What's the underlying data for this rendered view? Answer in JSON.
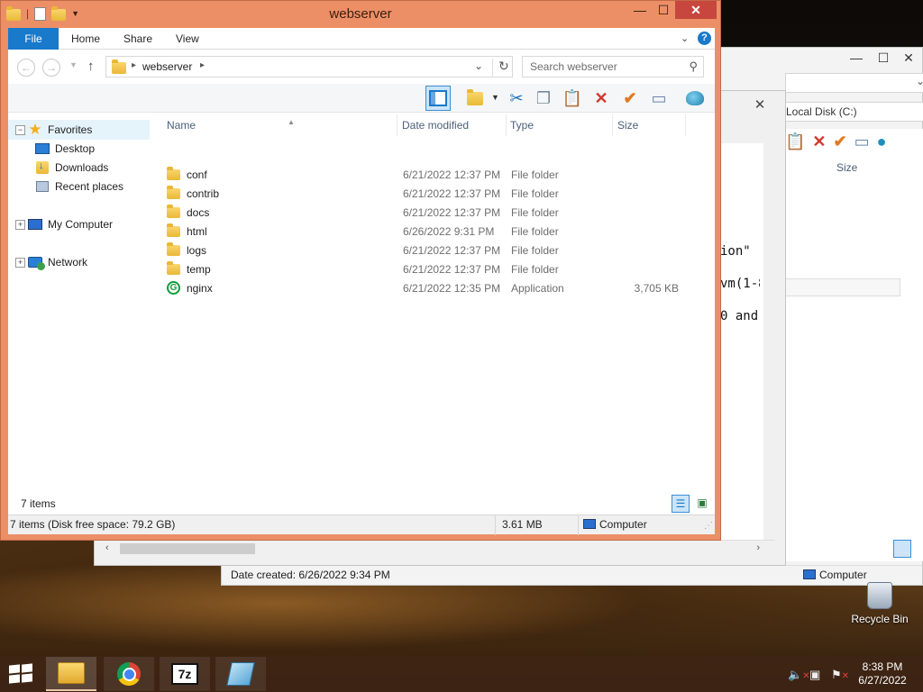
{
  "window": {
    "title": "webserver",
    "caption": {
      "minimize": "—",
      "maximize": "☐",
      "close": "✕"
    }
  },
  "ribbon": {
    "tabs": [
      "File",
      "Home",
      "Share",
      "View"
    ]
  },
  "navigation": {
    "back": "←",
    "forward": "→",
    "up": "↑",
    "breadcrumb": [
      "webserver"
    ],
    "refresh": "↻",
    "search_placeholder": "Search webserver"
  },
  "nav_pane": {
    "favorites": {
      "label": "Favorites",
      "expander": "−",
      "items": [
        "Desktop",
        "Downloads",
        "Recent places"
      ]
    },
    "my_computer": {
      "label": "My Computer",
      "expander": "+"
    },
    "network": {
      "label": "Network",
      "expander": "+"
    }
  },
  "columns": {
    "name": "Name",
    "date": "Date modified",
    "type": "Type",
    "size": "Size"
  },
  "files": [
    {
      "name": "conf",
      "date": "6/21/2022 12:37 PM",
      "type": "File folder",
      "size": "",
      "kind": "folder"
    },
    {
      "name": "contrib",
      "date": "6/21/2022 12:37 PM",
      "type": "File folder",
      "size": "",
      "kind": "folder"
    },
    {
      "name": "docs",
      "date": "6/21/2022 12:37 PM",
      "type": "File folder",
      "size": "",
      "kind": "folder"
    },
    {
      "name": "html",
      "date": "6/26/2022 9:31 PM",
      "type": "File folder",
      "size": "",
      "kind": "folder"
    },
    {
      "name": "logs",
      "date": "6/21/2022 12:37 PM",
      "type": "File folder",
      "size": "",
      "kind": "folder"
    },
    {
      "name": "temp",
      "date": "6/21/2022 12:37 PM",
      "type": "File folder",
      "size": "",
      "kind": "folder"
    },
    {
      "name": "nginx",
      "date": "6/21/2022 12:35 PM",
      "type": "Application",
      "size": "3,705 KB",
      "kind": "application"
    }
  ],
  "item_count": "7 items",
  "statusbar": {
    "summary": "7 items (Disk free space: 79.2 GB)",
    "size": "3.61 MB",
    "location": "Computer"
  },
  "background_window_1": {
    "editor_lines": [
      "ion\"",
      "vm(1-8",
      "0 and"
    ]
  },
  "background_window_2": {
    "address": "Local Disk (C:)",
    "column": "Size",
    "date_created": "Date created: 6/26/2022 9:34 PM",
    "location": "Computer"
  },
  "desktop": {
    "recycle_bin": "Recycle Bin"
  },
  "taskbar": {
    "time": "8:38 PM",
    "date": "6/27/2022",
    "z7_label": "7z"
  },
  "colors": {
    "title_bar": "#ec8f67",
    "file_tab": "#1979ca",
    "close_button": "#c7463d",
    "selection": "#e5f3fb"
  }
}
